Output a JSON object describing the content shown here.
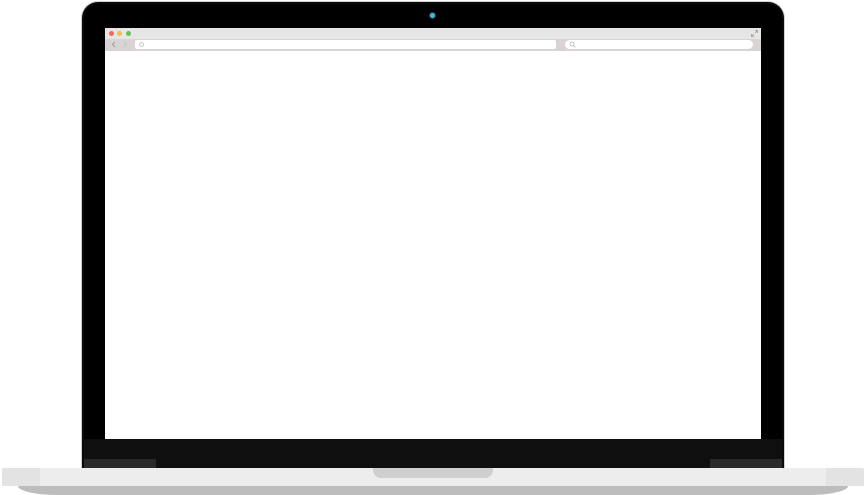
{
  "device": "laptop",
  "browser": {
    "url": "",
    "search": "",
    "window_controls": [
      "close",
      "minimize",
      "zoom"
    ],
    "icons": {
      "back": "back-arrow-icon",
      "forward": "forward-arrow-icon",
      "site": "globe-icon",
      "search": "search-icon",
      "fullscreen": "expand-icon"
    }
  },
  "colors": {
    "bezel": "#0a0a0a",
    "camera": "#47b9d6",
    "close": "#ef6b5e",
    "minimize": "#f5be4f",
    "zoom": "#60c454",
    "toolbar": "#d8d4d4",
    "base": "#e3e3e3"
  }
}
